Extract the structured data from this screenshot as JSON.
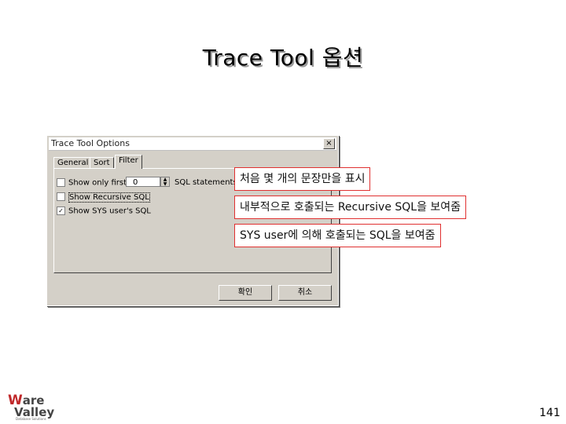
{
  "slide": {
    "title": "Trace Tool 옵션",
    "page_number": "141"
  },
  "dialog": {
    "title": "Trace Tool Options",
    "close_label": "×",
    "tabs": [
      {
        "label": "General"
      },
      {
        "label": "Sort"
      },
      {
        "label": "Filter",
        "active": true
      }
    ],
    "options": {
      "show_only_first": {
        "label": "Show only first",
        "checked": false
      },
      "count_value": "0",
      "sql_statements_label": "SQL statements",
      "show_recursive_sql": {
        "label": "Show Recursive SQL",
        "checked": false
      },
      "show_sys_users_sql": {
        "label": "Show SYS user's SQL",
        "checked": true,
        "mark": "✓"
      }
    },
    "ok_label": "확인",
    "cancel_label": "취소"
  },
  "callouts": [
    "처음 몇 개의 문장만을 표시",
    "내부적으로 호출되는 Recursive SQL을 보여줌",
    "SYS user에 의해 호출되는 SQL을 보여줌"
  ],
  "logo": {
    "line1_a": "W",
    "line1_b": "are",
    "line2": "Valley",
    "tagline": "Database Solutions"
  },
  "colors": {
    "dialog_bg": "#d4d0c8",
    "callout_border": "#e03030",
    "logo_red": "#c0282a"
  }
}
